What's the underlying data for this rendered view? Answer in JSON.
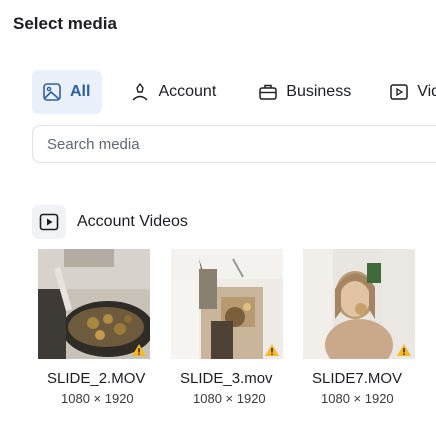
{
  "title": "Select media",
  "tabs": [
    {
      "label": "All",
      "icon": "image-icon",
      "active": true
    },
    {
      "label": "Account",
      "icon": "user-account-icon",
      "active": false
    },
    {
      "label": "Business",
      "icon": "briefcase-icon",
      "active": false
    },
    {
      "label": "Vide",
      "icon": "video-icon",
      "active": false
    }
  ],
  "search": {
    "placeholder": "Search media",
    "value": ""
  },
  "section": {
    "label": "Account Videos",
    "icon": "video-icon"
  },
  "media": [
    {
      "name": "SLIDE_2.MOV",
      "dims": "1080 × 1920",
      "warning": true
    },
    {
      "name": "SLIDE_3.mov",
      "dims": "1080 × 1920",
      "warning": true
    },
    {
      "name": "SLIDE7.MOV",
      "dims": "1080 × 1920",
      "warning": true
    }
  ],
  "colors": {
    "accent": "#2f5f9e",
    "active_tab_bg": "#eaf1fb",
    "warning": "#f7b928"
  }
}
